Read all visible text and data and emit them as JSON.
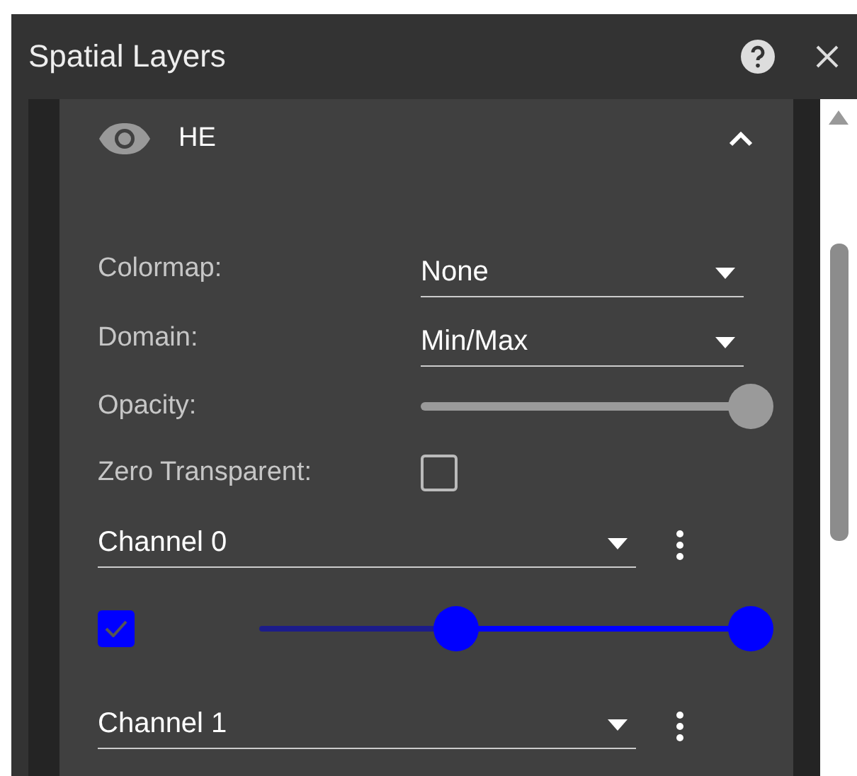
{
  "window": {
    "title": "Spatial Layers"
  },
  "layer": {
    "name": "HE",
    "visible": true,
    "expanded": true
  },
  "settings": [
    {
      "kind": "select",
      "label": "Colormap:",
      "value": "None"
    },
    {
      "kind": "select",
      "label": "Domain:",
      "value": "Min/Max"
    },
    {
      "kind": "slider",
      "label": "Opacity:",
      "level": 1
    },
    {
      "kind": "checkbox",
      "label": "Zero Transparent:",
      "checked": false
    }
  ],
  "channels": [
    {
      "name": "Channel 0",
      "checked": true,
      "color": "#0000ff",
      "thumbs": [
        {
          "level": 0.4
        },
        {
          "level": 1
        }
      ]
    },
    {
      "name": "Channel 1"
    }
  ]
}
